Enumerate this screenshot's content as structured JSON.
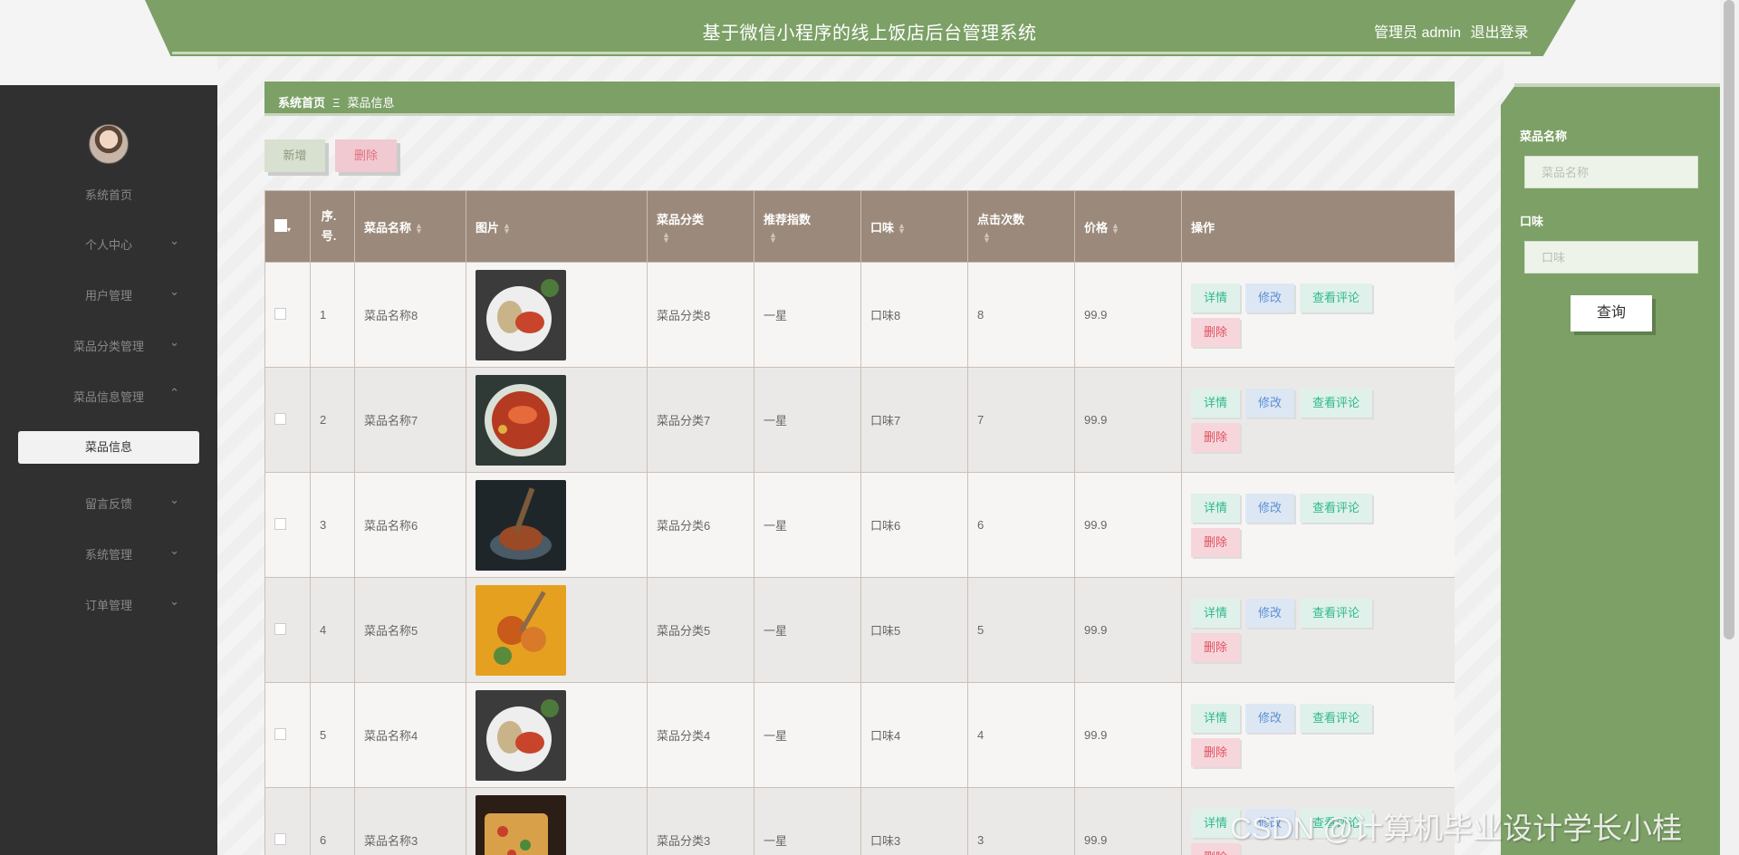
{
  "header": {
    "title": "基于微信小程序的线上饭店后台管理系统",
    "user_label": "管理员 admin",
    "logout": "退出登录"
  },
  "sidebar": {
    "items": [
      {
        "label": "系统首页",
        "chevron": ""
      },
      {
        "label": "个人中心",
        "chevron": "⌄"
      },
      {
        "label": "用户管理",
        "chevron": "⌄"
      },
      {
        "label": "菜品分类管理",
        "chevron": "⌄"
      },
      {
        "label": "菜品信息管理",
        "chevron": "⌃"
      },
      {
        "label": "留言反馈",
        "chevron": "⌄"
      },
      {
        "label": "系统管理",
        "chevron": "⌄"
      },
      {
        "label": "订单管理",
        "chevron": "⌄"
      }
    ],
    "active_sub": "菜品信息"
  },
  "breadcrumb": {
    "home": "系统首页",
    "sep": "Ξ",
    "current": "菜品信息"
  },
  "toolbar": {
    "add": "新增",
    "delete": "删除"
  },
  "table": {
    "headers": {
      "index": "序.号.",
      "name": "菜品名称",
      "image": "图片",
      "category": "菜品分类",
      "rating": "推荐指数",
      "taste": "口味",
      "clicks": "点击次数",
      "price": "价格",
      "actions": "操作"
    },
    "rows": [
      {
        "index": "1",
        "name": "菜品名称8",
        "category": "菜品分类8",
        "rating": "一星",
        "taste": "口味8",
        "clicks": "8",
        "price": "99.9",
        "img": "plate"
      },
      {
        "index": "2",
        "name": "菜品名称7",
        "category": "菜品分类7",
        "rating": "一星",
        "taste": "口味7",
        "clicks": "7",
        "price": "99.9",
        "img": "lobster"
      },
      {
        "index": "3",
        "name": "菜品名称6",
        "category": "菜品分类6",
        "rating": "一星",
        "taste": "口味6",
        "clicks": "6",
        "price": "99.9",
        "img": "dark"
      },
      {
        "index": "4",
        "name": "菜品名称5",
        "category": "菜品分类5",
        "rating": "一星",
        "taste": "口味5",
        "clicks": "5",
        "price": "99.9",
        "img": "fried"
      },
      {
        "index": "5",
        "name": "菜品名称4",
        "category": "菜品分类4",
        "rating": "一星",
        "taste": "口味4",
        "clicks": "4",
        "price": "99.9",
        "img": "plate"
      },
      {
        "index": "6",
        "name": "菜品名称3",
        "category": "菜品分类3",
        "rating": "一星",
        "taste": "口味3",
        "clicks": "3",
        "price": "99.9",
        "img": "pizza"
      }
    ],
    "row_actions": {
      "detail": "详情",
      "edit": "修改",
      "review": "查看评论",
      "delete": "删除"
    }
  },
  "search": {
    "name_label": "菜品名称",
    "name_placeholder": "菜品名称",
    "taste_label": "口味",
    "taste_placeholder": "口味",
    "submit": "查询"
  },
  "watermark": "CSDN @计算机毕业设计学长小桂"
}
